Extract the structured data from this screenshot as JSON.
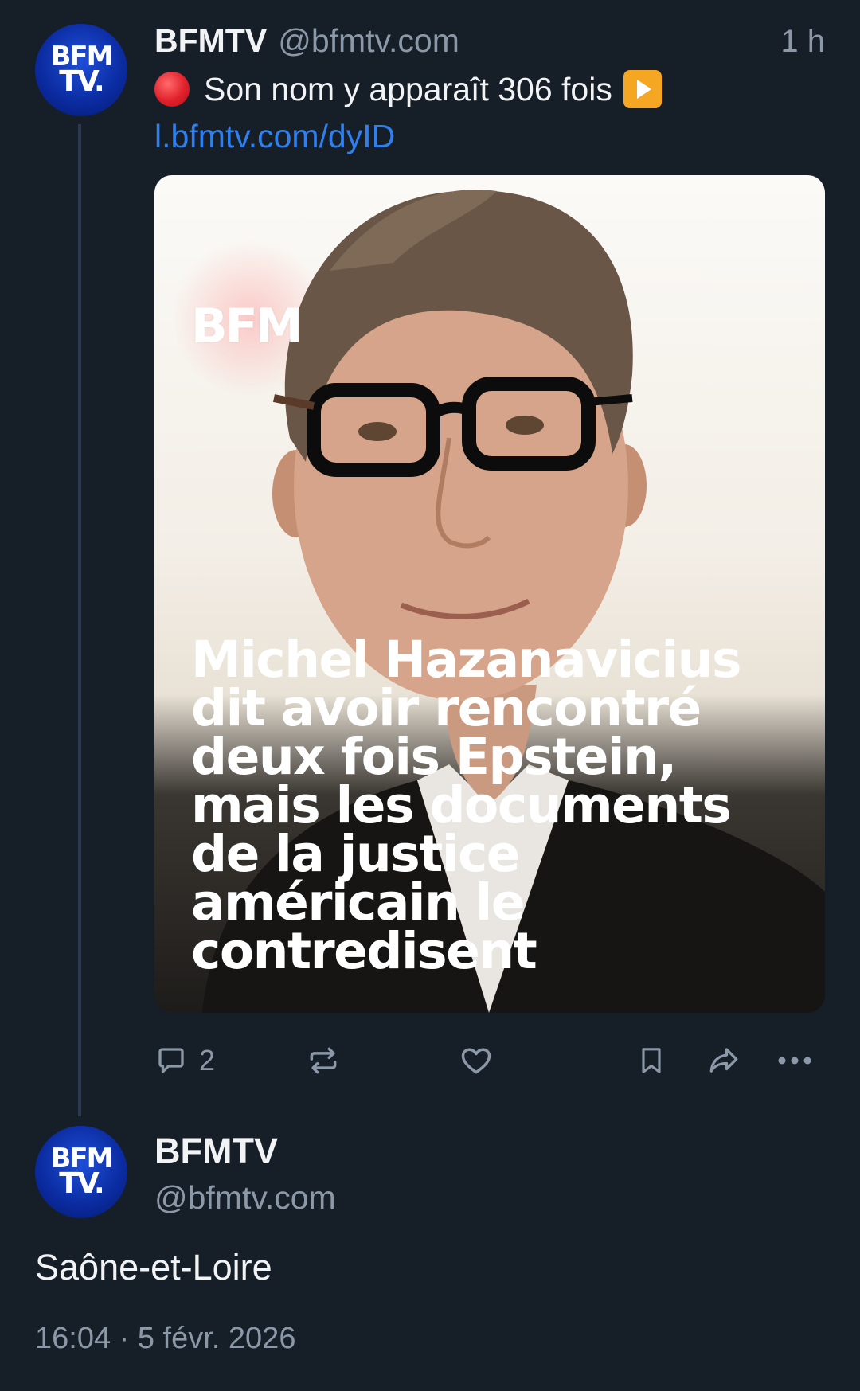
{
  "post": {
    "avatar": {
      "line1": "BFM",
      "line2": "TV."
    },
    "display_name": "BFMTV",
    "handle": "@bfmtv.com",
    "time_ago": "1 h",
    "text": "Son nom y apparaît 306 fois",
    "leading_emoji": "red-circle-icon",
    "trailing_emoji": "play-button-icon",
    "link": "l.bfmtv.com/dyID",
    "media": {
      "watermark": "BFM",
      "headline": "Michel Hazanavicius\ndit avoir rencontré\ndeux fois Epstein,\nmais les documents\nde la justice\naméricain le\ncontredisent"
    },
    "actions": {
      "reply_count": "2",
      "icons": [
        "reply-icon",
        "repost-icon",
        "like-icon",
        "bookmark-icon",
        "share-icon",
        "more-icon"
      ]
    }
  },
  "reply": {
    "avatar": {
      "line1": "BFM",
      "line2": "TV."
    },
    "display_name": "BFMTV",
    "handle": "@bfmtv.com",
    "text": "Saône-et-Loire",
    "timestamp": "16:04 · 5 févr. 2026"
  },
  "colors": {
    "background": "#161e27",
    "text_primary": "#f1f3f5",
    "text_secondary": "#8b98a8",
    "link": "#2f80ed",
    "avatar_blue": "#0a2a9e",
    "thread_line": "#2a3a4f"
  }
}
